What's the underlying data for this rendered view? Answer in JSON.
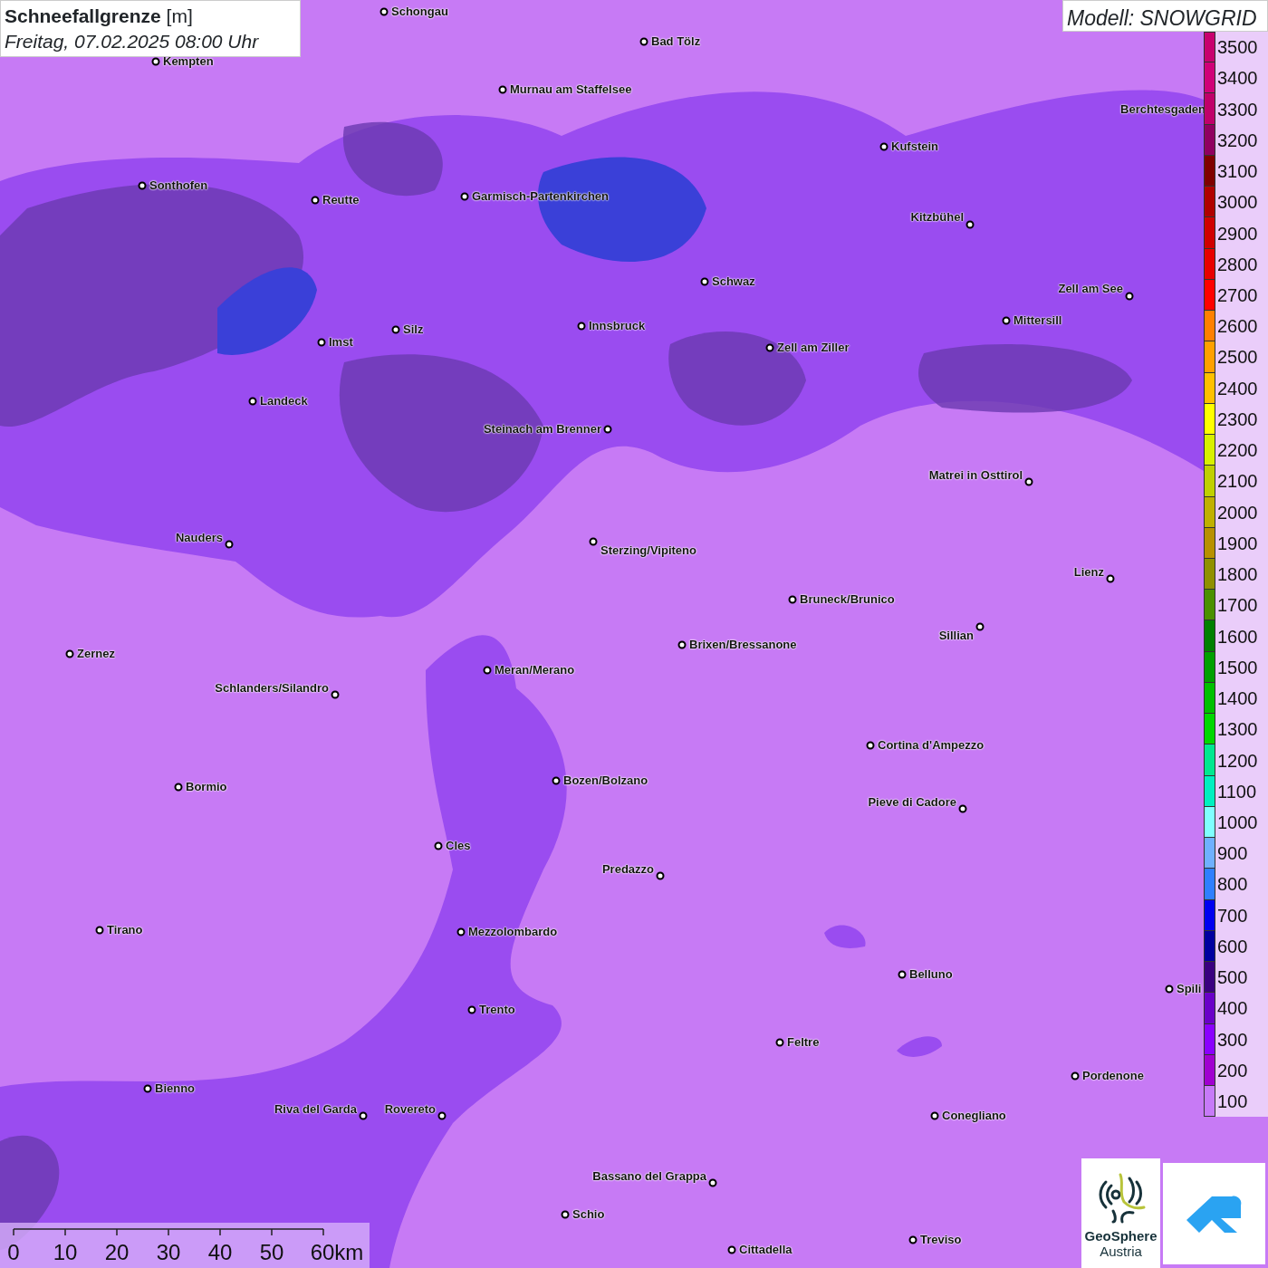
{
  "title": {
    "heading": "Schneefallgrenze",
    "unit": "[m]",
    "datetime": "Freitag, 07.02.2025 08:00 Uhr"
  },
  "model_label": "Modell: SNOWGRID",
  "towns": [
    {
      "name": "Schongau"
    },
    {
      "name": "Bad Tölz"
    },
    {
      "name": "Kempten"
    },
    {
      "name": "Murnau am Staffelsee"
    },
    {
      "name": "Kufstein"
    },
    {
      "name": "Berchtesgaden"
    },
    {
      "name": "Sonthofen"
    },
    {
      "name": "Reutte"
    },
    {
      "name": "Garmisch-Partenkirchen"
    },
    {
      "name": "Kitzbühel"
    },
    {
      "name": "Schwaz"
    },
    {
      "name": "Zell am See"
    },
    {
      "name": "Mittersill"
    },
    {
      "name": "Innsbruck"
    },
    {
      "name": "Zell am Ziller"
    },
    {
      "name": "Imst"
    },
    {
      "name": "Silz"
    },
    {
      "name": "Landeck"
    },
    {
      "name": "Steinach am Brenner"
    },
    {
      "name": "Matrei in Osttirol"
    },
    {
      "name": "Nauders"
    },
    {
      "name": "Sterzing/Vipiteno"
    },
    {
      "name": "Lienz"
    },
    {
      "name": "Bruneck/Brunico"
    },
    {
      "name": "Sillian"
    },
    {
      "name": "Zernez"
    },
    {
      "name": "Brixen/Bressanone"
    },
    {
      "name": "Meran/Merano"
    },
    {
      "name": "Schlanders/Silandro"
    },
    {
      "name": "Cortina d'Ampezzo"
    },
    {
      "name": "Bozen/Bolzano"
    },
    {
      "name": "Bormio"
    },
    {
      "name": "Pieve di Cadore"
    },
    {
      "name": "Cles"
    },
    {
      "name": "Predazzo"
    },
    {
      "name": "Tirano"
    },
    {
      "name": "Mezzolombardo"
    },
    {
      "name": "Belluno"
    },
    {
      "name": "Spili"
    },
    {
      "name": "Trento"
    },
    {
      "name": "Feltre"
    },
    {
      "name": "Pordenone"
    },
    {
      "name": "Bienno"
    },
    {
      "name": "Riva del Garda"
    },
    {
      "name": "Rovereto"
    },
    {
      "name": "Conegliano"
    },
    {
      "name": "Bassano del Grappa"
    },
    {
      "name": "Schio"
    },
    {
      "name": "Treviso"
    },
    {
      "name": "Cittadella"
    }
  ],
  "legend": {
    "items": [
      {
        "label": "3500",
        "color": "#c8006e"
      },
      {
        "label": "3400",
        "color": "#d00078"
      },
      {
        "label": "3300",
        "color": "#c0006a"
      },
      {
        "label": "3200",
        "color": "#900060"
      },
      {
        "label": "3100",
        "color": "#800000"
      },
      {
        "label": "3000",
        "color": "#b00000"
      },
      {
        "label": "2900",
        "color": "#d00000"
      },
      {
        "label": "2800",
        "color": "#e80000"
      },
      {
        "label": "2700",
        "color": "#ff0000"
      },
      {
        "label": "2600",
        "color": "#ff8000"
      },
      {
        "label": "2500",
        "color": "#ffa000"
      },
      {
        "label": "2400",
        "color": "#ffc000"
      },
      {
        "label": "2300",
        "color": "#ffff00"
      },
      {
        "label": "2200",
        "color": "#d8f000"
      },
      {
        "label": "2100",
        "color": "#c0d000"
      },
      {
        "label": "2000",
        "color": "#c0b000"
      },
      {
        "label": "1900",
        "color": "#b89000"
      },
      {
        "label": "1800",
        "color": "#909000"
      },
      {
        "label": "1700",
        "color": "#4a9000"
      },
      {
        "label": "1600",
        "color": "#008000"
      },
      {
        "label": "1500",
        "color": "#00a000"
      },
      {
        "label": "1400",
        "color": "#00c000"
      },
      {
        "label": "1300",
        "color": "#00d800"
      },
      {
        "label": "1200",
        "color": "#00e890"
      },
      {
        "label": "1100",
        "color": "#00f0c0"
      },
      {
        "label": "1000",
        "color": "#80ffff"
      },
      {
        "label": "900",
        "color": "#6fb0ff"
      },
      {
        "label": "800",
        "color": "#2f7fff"
      },
      {
        "label": "700",
        "color": "#0000f0"
      },
      {
        "label": "600",
        "color": "#0000a0"
      },
      {
        "label": "500",
        "color": "#3a0080"
      },
      {
        "label": "400",
        "color": "#6a00c8"
      },
      {
        "label": "300",
        "color": "#8a00ff"
      },
      {
        "label": "200",
        "color": "#a000d0"
      },
      {
        "label": "100",
        "color": "#c77af8"
      }
    ]
  },
  "scale_bar": {
    "labels": [
      "0",
      "10",
      "20",
      "30",
      "40",
      "50",
      "60km"
    ]
  },
  "logos": {
    "geosphere": {
      "name": "GeoSphere",
      "sub": "Austria"
    }
  }
}
